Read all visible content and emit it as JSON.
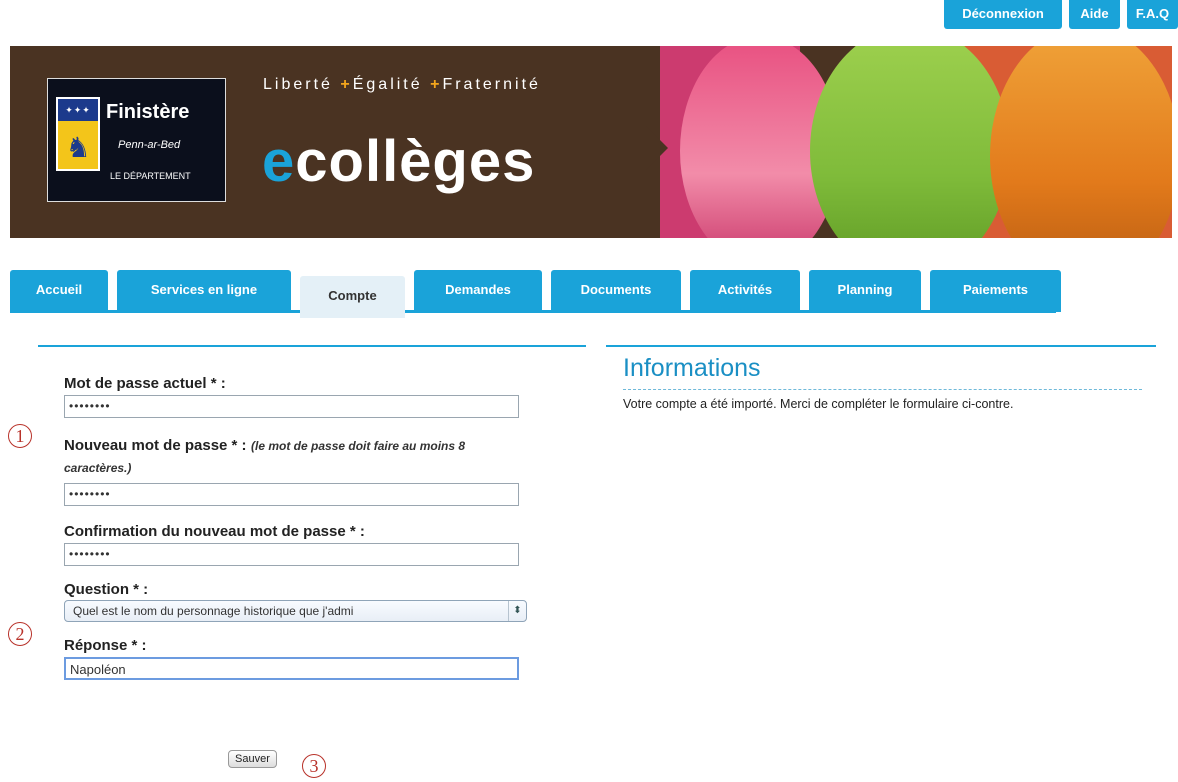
{
  "top_links": [
    "Déconnexion",
    "Aide",
    "F.A.Q"
  ],
  "banner": {
    "logo_name": "Finistère",
    "logo_sub": "Penn-ar-Bed",
    "logo_dept": "LE DÉPARTEMENT",
    "motto_1": "Liberté",
    "motto_2": "Égalité",
    "motto_3": "Fraternité",
    "motto_plus": "+",
    "brand_e": "e",
    "brand_rest": "collèges"
  },
  "tabs": [
    {
      "label": "Accueil",
      "active": false
    },
    {
      "label": "Services en ligne",
      "active": false
    },
    {
      "label": "Compte",
      "active": true
    },
    {
      "label": "Demandes",
      "active": false
    },
    {
      "label": "Documents",
      "active": false
    },
    {
      "label": "Activités",
      "active": false
    },
    {
      "label": "Planning",
      "active": false
    },
    {
      "label": "Paiements",
      "active": false
    }
  ],
  "form": {
    "current_password_label": "Mot de passe actuel * :",
    "current_password_value": "••••••••",
    "new_password_label": "Nouveau mot de passe * :",
    "new_password_hint": "(le mot de passe doit faire au moins 8 caractères.)",
    "new_password_value": "••••••••",
    "confirm_password_label": "Confirmation du nouveau mot de passe * :",
    "confirm_password_value": "••••••••",
    "question_label": "Question * :",
    "question_value": "Quel est le nom du personnage historique que j'admi",
    "answer_label": "Réponse * :",
    "answer_value": "Napoléon",
    "save_label": "Sauver"
  },
  "callouts": [
    "1",
    "2",
    "3"
  ],
  "info": {
    "title": "Informations",
    "text": "Votre compte a été importé. Merci de compléter le formulaire ci-contre."
  },
  "colors": {
    "accent": "#1aa3d9",
    "banner_bg": "#4a3322",
    "callout": "#b8322a"
  }
}
